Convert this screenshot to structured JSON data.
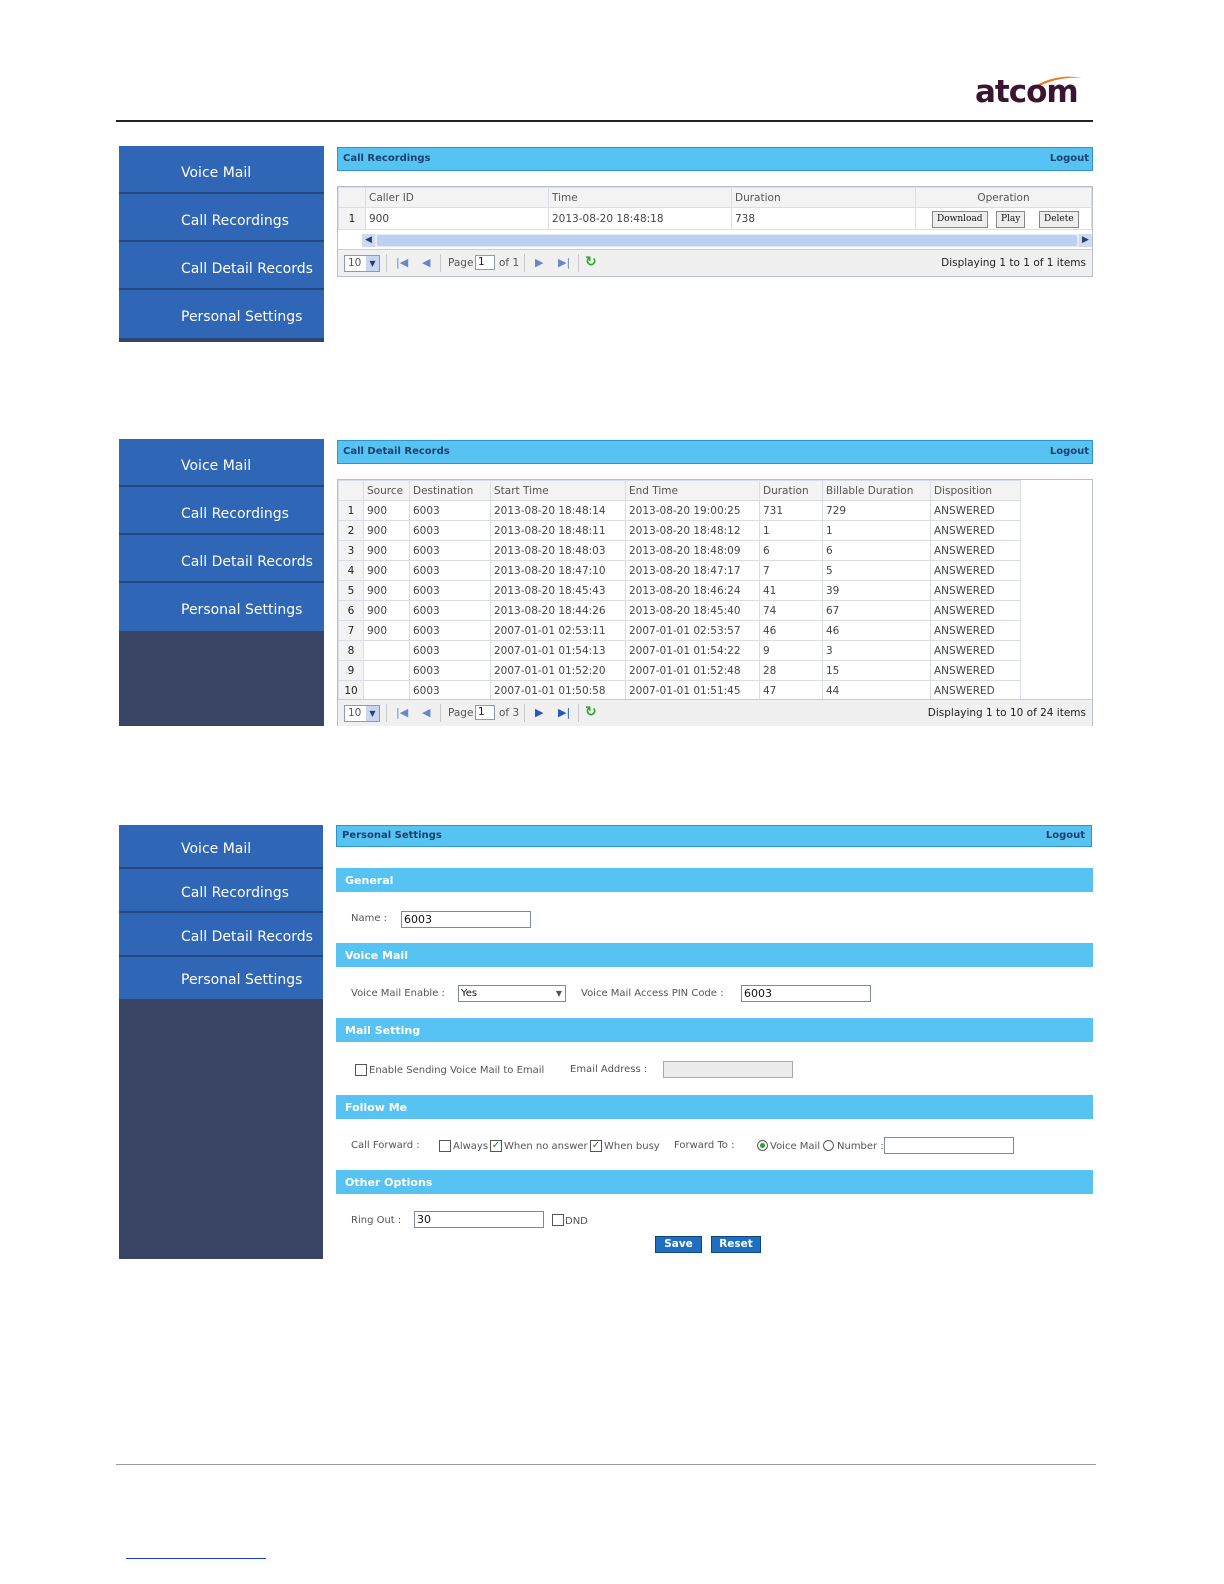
{
  "logo": {
    "text": "atcom"
  },
  "nav": [
    "Voice Mail",
    "Call Recordings",
    "Call Detail Records",
    "Personal Settings"
  ],
  "recordings": {
    "title": "Call Recordings",
    "logout": "Logout",
    "columns": [
      "Caller ID",
      "Time",
      "Duration",
      "Operation"
    ],
    "rows": [
      {
        "n": "1",
        "caller": "900",
        "time": "2013-08-20 18:48:18",
        "duration": "738"
      }
    ],
    "ops": {
      "download": "Download",
      "play": "Play",
      "delete": "Delete"
    },
    "pager": {
      "size": "10",
      "page_label": "Page",
      "page": "1",
      "of": "of 1",
      "display": "Displaying 1 to 1 of 1 items"
    }
  },
  "cdr": {
    "title": "Call Detail Records",
    "logout": "Logout",
    "columns": [
      "Source",
      "Destination",
      "Start Time",
      "End Time",
      "Duration",
      "Billable Duration",
      "Disposition"
    ],
    "rows": [
      [
        "1",
        "900",
        "6003",
        "2013-08-20 18:48:14",
        "2013-08-20 19:00:25",
        "731",
        "729",
        "ANSWERED"
      ],
      [
        "2",
        "900",
        "6003",
        "2013-08-20 18:48:11",
        "2013-08-20 18:48:12",
        "1",
        "1",
        "ANSWERED"
      ],
      [
        "3",
        "900",
        "6003",
        "2013-08-20 18:48:03",
        "2013-08-20 18:48:09",
        "6",
        "6",
        "ANSWERED"
      ],
      [
        "4",
        "900",
        "6003",
        "2013-08-20 18:47:10",
        "2013-08-20 18:47:17",
        "7",
        "5",
        "ANSWERED"
      ],
      [
        "5",
        "900",
        "6003",
        "2013-08-20 18:45:43",
        "2013-08-20 18:46:24",
        "41",
        "39",
        "ANSWERED"
      ],
      [
        "6",
        "900",
        "6003",
        "2013-08-20 18:44:26",
        "2013-08-20 18:45:40",
        "74",
        "67",
        "ANSWERED"
      ],
      [
        "7",
        "900",
        "6003",
        "2007-01-01 02:53:11",
        "2007-01-01 02:53:57",
        "46",
        "46",
        "ANSWERED"
      ],
      [
        "8",
        "",
        "6003",
        "2007-01-01 01:54:13",
        "2007-01-01 01:54:22",
        "9",
        "3",
        "ANSWERED"
      ],
      [
        "9",
        "",
        "6003",
        "2007-01-01 01:52:20",
        "2007-01-01 01:52:48",
        "28",
        "15",
        "ANSWERED"
      ],
      [
        "10",
        "",
        "6003",
        "2007-01-01 01:50:58",
        "2007-01-01 01:51:45",
        "47",
        "44",
        "ANSWERED"
      ]
    ],
    "pager": {
      "size": "10",
      "page_label": "Page",
      "page": "1",
      "of": "of 3",
      "display": "Displaying 1 to 10 of 24 items"
    }
  },
  "settings": {
    "title": "Personal Settings",
    "logout": "Logout",
    "general": {
      "header": "General",
      "name_label": "Name :",
      "name_value": "6003"
    },
    "voicemail": {
      "header": "Voice Mail",
      "enable_label": "Voice Mail Enable :",
      "enable_value": "Yes",
      "pin_label": "Voice Mail Access PIN Code :",
      "pin_value": "6003"
    },
    "mail": {
      "header": "Mail Setting",
      "send_label": "Enable Sending Voice Mail to Email",
      "email_label": "Email Address :",
      "email_value": ""
    },
    "follow": {
      "header": "Follow Me",
      "forward_label": "Call Forward :",
      "always": "Always",
      "no_answer": "When no answer",
      "busy": "When busy",
      "forward_to_label": "Forward To :",
      "voice_mail": "Voice Mail",
      "number": "Number :",
      "number_value": ""
    },
    "other": {
      "header": "Other Options",
      "ring_label": "Ring Out :",
      "ring_value": "30",
      "dnd": "DND"
    },
    "save": "Save",
    "reset": "Reset"
  }
}
